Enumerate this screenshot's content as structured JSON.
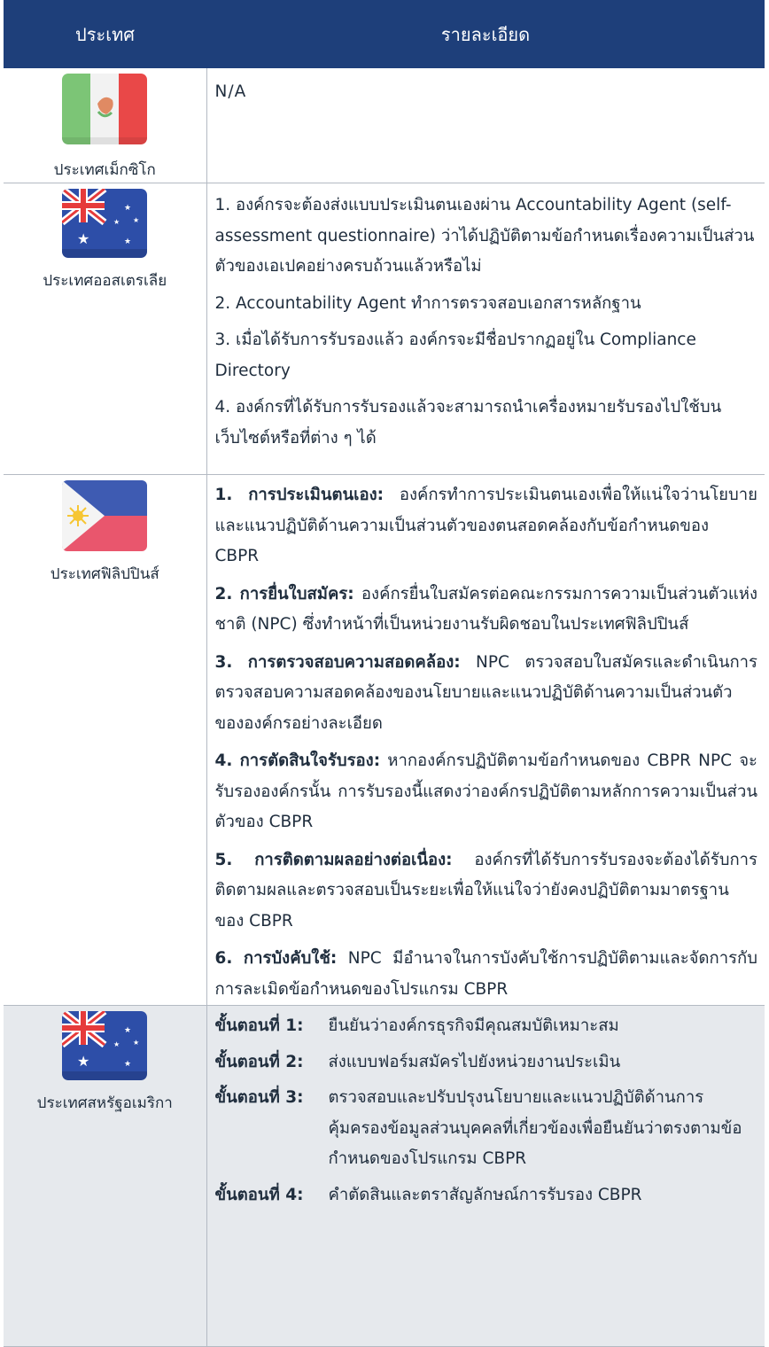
{
  "header": {
    "col_country": "ประเทศ",
    "col_detail": "รายละเอียด"
  },
  "rows": {
    "mexico": {
      "flag": "mexico-flag-icon",
      "country": "ประเทศเม็กซิโก",
      "detail": "N/A"
    },
    "australia": {
      "flag": "australia-flag-icon",
      "country": "ประเทศออสเตรเลีย",
      "items": [
        "1. องค์กรจะต้องส่งแบบประเมินตนเองผ่าน Accountability Agent (self-assessment questionnaire) ว่าได้ปฏิบัติตามข้อกำหนดเรื่องความเป็นส่วนตัวของเอเปคอย่างครบถ้วนแล้วหรือไม่",
        "2. Accountability Agent ทำการตรวจสอบเอกสารหลักฐาน",
        "3. เมื่อได้รับการรับรองแล้ว องค์กรจะมีชื่อปรากฏอยู่ใน Compliance Directory",
        "4. องค์กรที่ได้รับการรับรองแล้วจะสามารถนำเครื่องหมายรับรองไปใช้บนเว็บไซต์หรือที่ต่าง ๆ ได้"
      ]
    },
    "philippines": {
      "flag": "philippines-flag-icon",
      "country": "ประเทศฟิลิปปินส์",
      "items": [
        {
          "num": "1.",
          "title": "การประเมินตนเอง:",
          "text": " องค์กรทำการประเมินตนเองเพื่อให้แน่ใจว่านโยบายและแนวปฏิบัติด้านความเป็นส่วนตัวของตนสอดคล้องกับข้อกำหนดของ CBPR"
        },
        {
          "num": "2.",
          "title": "การยื่นใบสมัคร:",
          "text": " องค์กรยื่นใบสมัครต่อคณะกรรมการความเป็นส่วนตัวแห่งชาติ (NPC) ซึ่งทำหน้าที่เป็นหน่วยงานรับผิดชอบในประเทศฟิลิปปินส์"
        },
        {
          "num": "3.",
          "title": "การตรวจสอบความสอดคล้อง:",
          "text": " NPC ตรวจสอบใบสมัครและดำเนินการตรวจสอบความสอดคล้องของนโยบายและแนวปฏิบัติด้านความเป็นส่วนตัวขององค์กรอย่างละเอียด"
        },
        {
          "num": "4.",
          "title": "การตัดสินใจรับรอง:",
          "text": " หากองค์กรปฏิบัติตามข้อกำหนดของ CBPR NPC จะรับรององค์กรนั้น การรับรองนี้แสดงว่าองค์กรปฏิบัติตามหลักการความเป็นส่วนตัวของ CBPR"
        },
        {
          "num": "5.",
          "title": "การติดตามผลอย่างต่อเนื่อง:",
          "text": " องค์กรที่ได้รับการรับรองจะต้องได้รับการติดตามผลและตรวจสอบเป็นระยะเพื่อให้แน่ใจว่ายังคงปฏิบัติตามมาตรฐานของ CBPR"
        },
        {
          "num": "6.",
          "title": "การบังคับใช้:",
          "text": " NPC มีอำนาจในการบังคับใช้การปฏิบัติตามและจัดการกับการละเมิดข้อกำหนดของโปรแกรม CBPR"
        }
      ]
    },
    "usa": {
      "flag": "australia-flag-icon",
      "country": "ประเทศสหรัฐอเมริกา",
      "steps": [
        {
          "label": "ขั้นตอนที่ 1:",
          "text": "ยืนยันว่าองค์กรธุรกิจมีคุณสมบัติเหมาะสม"
        },
        {
          "label": "ขั้นตอนที่ 2:",
          "text": "ส่งแบบฟอร์มสมัครไปยังหน่วยงานประเมิน"
        },
        {
          "label": "ขั้นตอนที่ 3:",
          "text": "ตรวจสอบและปรับปรุงนโยบายและแนวปฏิบัติด้านการคุ้มครองข้อมูลส่วนบุคคลที่เกี่ยวข้องเพื่อยืนยันว่าตรงตามข้อกำหนดของโปรแกรม CBPR"
        },
        {
          "label": "ขั้นตอนที่ 4:",
          "text": "คำตัดสินและตราสัญลักษณ์การรับรอง CBPR"
        }
      ]
    }
  },
  "colors": {
    "header_bg": "#1e3f7a",
    "header_text": "#ffffff",
    "border": "#b4bac3",
    "last_row_bg": "#e6e9ed"
  }
}
